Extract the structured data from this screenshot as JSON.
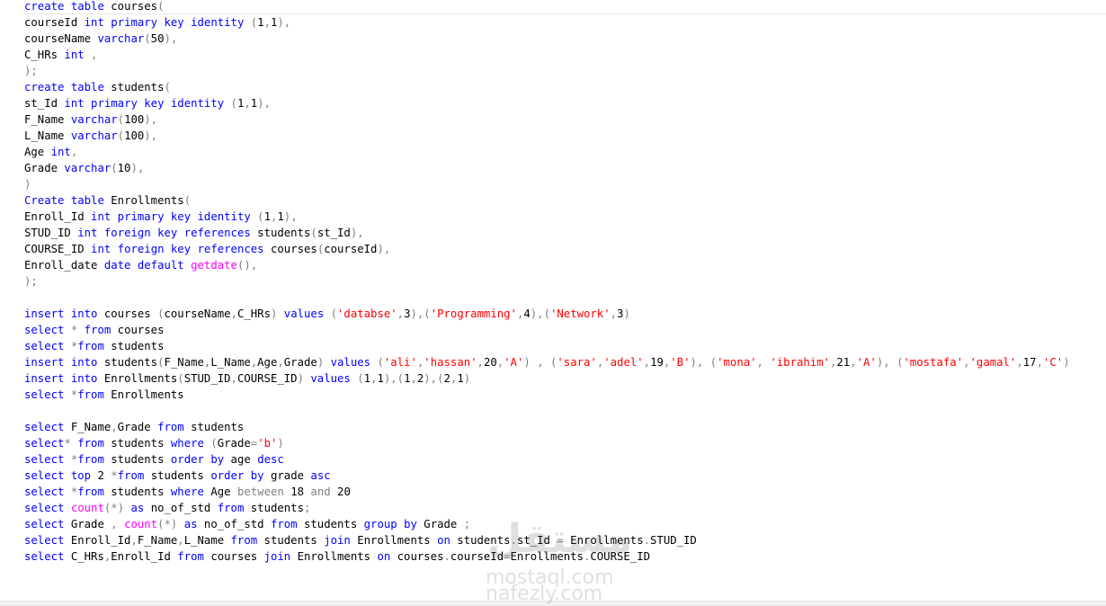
{
  "colors": {
    "keyword": "#0000ff",
    "string": "#ff0000",
    "function": "#ff00ff",
    "operator": "#808080",
    "identifier": "#000000"
  },
  "watermark": {
    "logo": "مستقل",
    "line1": "mostaql.com",
    "line2": "nafezly.com"
  },
  "lines": [
    [
      [
        "kw",
        "create"
      ],
      [
        "id",
        " "
      ],
      [
        "kw",
        "table"
      ],
      [
        "id",
        " courses"
      ],
      [
        "op",
        "("
      ]
    ],
    [
      [
        "id",
        "courseId "
      ],
      [
        "kw",
        "int"
      ],
      [
        "id",
        " "
      ],
      [
        "kw",
        "primary"
      ],
      [
        "id",
        " "
      ],
      [
        "kw",
        "key"
      ],
      [
        "id",
        " "
      ],
      [
        "kw",
        "identity"
      ],
      [
        "id",
        " "
      ],
      [
        "op",
        "("
      ],
      [
        "id",
        "1"
      ],
      [
        "op",
        ","
      ],
      [
        "id",
        "1"
      ],
      [
        "op",
        "),"
      ]
    ],
    [
      [
        "id",
        "courseName "
      ],
      [
        "kw",
        "varchar"
      ],
      [
        "op",
        "("
      ],
      [
        "id",
        "50"
      ],
      [
        "op",
        "),"
      ]
    ],
    [
      [
        "id",
        "C_HRs "
      ],
      [
        "kw",
        "int"
      ],
      [
        "id",
        " "
      ],
      [
        "op",
        ","
      ]
    ],
    [
      [
        "op",
        ");"
      ]
    ],
    [
      [
        "kw",
        "create"
      ],
      [
        "id",
        " "
      ],
      [
        "kw",
        "table"
      ],
      [
        "id",
        " students"
      ],
      [
        "op",
        "("
      ]
    ],
    [
      [
        "id",
        "st_Id "
      ],
      [
        "kw",
        "int"
      ],
      [
        "id",
        " "
      ],
      [
        "kw",
        "primary"
      ],
      [
        "id",
        " "
      ],
      [
        "kw",
        "key"
      ],
      [
        "id",
        " "
      ],
      [
        "kw",
        "identity"
      ],
      [
        "id",
        " "
      ],
      [
        "op",
        "("
      ],
      [
        "id",
        "1"
      ],
      [
        "op",
        ","
      ],
      [
        "id",
        "1"
      ],
      [
        "op",
        "),"
      ]
    ],
    [
      [
        "id",
        "F_Name "
      ],
      [
        "kw",
        "varchar"
      ],
      [
        "op",
        "("
      ],
      [
        "id",
        "100"
      ],
      [
        "op",
        "),"
      ]
    ],
    [
      [
        "id",
        "L_Name "
      ],
      [
        "kw",
        "varchar"
      ],
      [
        "op",
        "("
      ],
      [
        "id",
        "100"
      ],
      [
        "op",
        "),"
      ]
    ],
    [
      [
        "id",
        "Age "
      ],
      [
        "kw",
        "int"
      ],
      [
        "op",
        ","
      ]
    ],
    [
      [
        "id",
        "Grade "
      ],
      [
        "kw",
        "varchar"
      ],
      [
        "op",
        "("
      ],
      [
        "id",
        "10"
      ],
      [
        "op",
        "),"
      ]
    ],
    [
      [
        "op",
        ")"
      ]
    ],
    [
      [
        "kw",
        "Create"
      ],
      [
        "id",
        " "
      ],
      [
        "kw",
        "table"
      ],
      [
        "id",
        " Enrollments"
      ],
      [
        "op",
        "("
      ]
    ],
    [
      [
        "id",
        "Enroll_Id "
      ],
      [
        "kw",
        "int"
      ],
      [
        "id",
        " "
      ],
      [
        "kw",
        "primary"
      ],
      [
        "id",
        " "
      ],
      [
        "kw",
        "key"
      ],
      [
        "id",
        " "
      ],
      [
        "kw",
        "identity"
      ],
      [
        "id",
        " "
      ],
      [
        "op",
        "("
      ],
      [
        "id",
        "1"
      ],
      [
        "op",
        ","
      ],
      [
        "id",
        "1"
      ],
      [
        "op",
        "),"
      ]
    ],
    [
      [
        "id",
        "STUD_ID "
      ],
      [
        "kw",
        "int"
      ],
      [
        "id",
        " "
      ],
      [
        "kw",
        "foreign"
      ],
      [
        "id",
        " "
      ],
      [
        "kw",
        "key"
      ],
      [
        "id",
        " "
      ],
      [
        "kw",
        "references"
      ],
      [
        "id",
        " students"
      ],
      [
        "op",
        "("
      ],
      [
        "id",
        "st_Id"
      ],
      [
        "op",
        "),"
      ]
    ],
    [
      [
        "id",
        "COURSE_ID "
      ],
      [
        "kw",
        "int"
      ],
      [
        "id",
        " "
      ],
      [
        "kw",
        "foreign"
      ],
      [
        "id",
        " "
      ],
      [
        "kw",
        "key"
      ],
      [
        "id",
        " "
      ],
      [
        "kw",
        "references"
      ],
      [
        "id",
        " courses"
      ],
      [
        "op",
        "("
      ],
      [
        "id",
        "courseId"
      ],
      [
        "op",
        "),"
      ]
    ],
    [
      [
        "id",
        "Enroll_date "
      ],
      [
        "kw",
        "date"
      ],
      [
        "id",
        " "
      ],
      [
        "kw",
        "default"
      ],
      [
        "id",
        " "
      ],
      [
        "fn",
        "getdate"
      ],
      [
        "op",
        "(),"
      ]
    ],
    [
      [
        "op",
        ");"
      ]
    ],
    [],
    [
      [
        "kw",
        "insert"
      ],
      [
        "id",
        " "
      ],
      [
        "kw",
        "into"
      ],
      [
        "id",
        " courses "
      ],
      [
        "op",
        "("
      ],
      [
        "id",
        "courseName"
      ],
      [
        "op",
        ","
      ],
      [
        "id",
        "C_HRs"
      ],
      [
        "op",
        ")"
      ],
      [
        "id",
        " "
      ],
      [
        "kw",
        "values"
      ],
      [
        "id",
        " "
      ],
      [
        "op",
        "("
      ],
      [
        "str",
        "'databse'"
      ],
      [
        "op",
        ","
      ],
      [
        "id",
        "3"
      ],
      [
        "op",
        "),("
      ],
      [
        "str",
        "'Programming'"
      ],
      [
        "op",
        ","
      ],
      [
        "id",
        "4"
      ],
      [
        "op",
        "),("
      ],
      [
        "str",
        "'Network'"
      ],
      [
        "op",
        ","
      ],
      [
        "id",
        "3"
      ],
      [
        "op",
        ")"
      ]
    ],
    [
      [
        "kw",
        "select"
      ],
      [
        "id",
        " "
      ],
      [
        "op",
        "*"
      ],
      [
        "id",
        " "
      ],
      [
        "kw",
        "from"
      ],
      [
        "id",
        " courses"
      ]
    ],
    [
      [
        "kw",
        "select"
      ],
      [
        "id",
        " "
      ],
      [
        "op",
        "*"
      ],
      [
        "kw",
        "from"
      ],
      [
        "id",
        " students"
      ]
    ],
    [
      [
        "kw",
        "insert"
      ],
      [
        "id",
        " "
      ],
      [
        "kw",
        "into"
      ],
      [
        "id",
        " students"
      ],
      [
        "op",
        "("
      ],
      [
        "id",
        "F_Name"
      ],
      [
        "op",
        ","
      ],
      [
        "id",
        "L_Name"
      ],
      [
        "op",
        ","
      ],
      [
        "id",
        "Age"
      ],
      [
        "op",
        ","
      ],
      [
        "id",
        "Grade"
      ],
      [
        "op",
        ")"
      ],
      [
        "id",
        " "
      ],
      [
        "kw",
        "values"
      ],
      [
        "id",
        " "
      ],
      [
        "op",
        "("
      ],
      [
        "str",
        "'ali'"
      ],
      [
        "op",
        ","
      ],
      [
        "str",
        "'hassan'"
      ],
      [
        "op",
        ","
      ],
      [
        "id",
        "20"
      ],
      [
        "op",
        ","
      ],
      [
        "str",
        "'A'"
      ],
      [
        "op",
        ")"
      ],
      [
        "id",
        " "
      ],
      [
        "op",
        ","
      ],
      [
        "id",
        " "
      ],
      [
        "op",
        "("
      ],
      [
        "str",
        "'sara'"
      ],
      [
        "op",
        ","
      ],
      [
        "str",
        "'adel'"
      ],
      [
        "op",
        ","
      ],
      [
        "id",
        "19"
      ],
      [
        "op",
        ","
      ],
      [
        "str",
        "'B'"
      ],
      [
        "op",
        "),"
      ],
      [
        "id",
        " "
      ],
      [
        "op",
        "("
      ],
      [
        "str",
        "'mona'"
      ],
      [
        "op",
        ","
      ],
      [
        "id",
        " "
      ],
      [
        "str",
        "'ibrahim'"
      ],
      [
        "op",
        ","
      ],
      [
        "id",
        "21"
      ],
      [
        "op",
        ","
      ],
      [
        "str",
        "'A'"
      ],
      [
        "op",
        "),"
      ],
      [
        "id",
        " "
      ],
      [
        "op",
        "("
      ],
      [
        "str",
        "'mostafa'"
      ],
      [
        "op",
        ","
      ],
      [
        "str",
        "'gamal'"
      ],
      [
        "op",
        ","
      ],
      [
        "id",
        "17"
      ],
      [
        "op",
        ","
      ],
      [
        "str",
        "'C'"
      ],
      [
        "op",
        ")"
      ]
    ],
    [
      [
        "kw",
        "insert"
      ],
      [
        "id",
        " "
      ],
      [
        "kw",
        "into"
      ],
      [
        "id",
        " Enrollments"
      ],
      [
        "op",
        "("
      ],
      [
        "id",
        "STUD_ID"
      ],
      [
        "op",
        ","
      ],
      [
        "id",
        "COURSE_ID"
      ],
      [
        "op",
        ")"
      ],
      [
        "id",
        " "
      ],
      [
        "kw",
        "values"
      ],
      [
        "id",
        " "
      ],
      [
        "op",
        "("
      ],
      [
        "id",
        "1"
      ],
      [
        "op",
        ","
      ],
      [
        "id",
        "1"
      ],
      [
        "op",
        "),("
      ],
      [
        "id",
        "1"
      ],
      [
        "op",
        ","
      ],
      [
        "id",
        "2"
      ],
      [
        "op",
        "),("
      ],
      [
        "id",
        "2"
      ],
      [
        "op",
        ","
      ],
      [
        "id",
        "1"
      ],
      [
        "op",
        ")"
      ]
    ],
    [
      [
        "kw",
        "select"
      ],
      [
        "id",
        " "
      ],
      [
        "op",
        "*"
      ],
      [
        "kw",
        "from"
      ],
      [
        "id",
        " Enrollments"
      ]
    ],
    [],
    [
      [
        "kw",
        "select"
      ],
      [
        "id",
        " F_Name"
      ],
      [
        "op",
        ","
      ],
      [
        "id",
        "Grade "
      ],
      [
        "kw",
        "from"
      ],
      [
        "id",
        " students"
      ]
    ],
    [
      [
        "kw",
        "select"
      ],
      [
        "op",
        "*"
      ],
      [
        "id",
        " "
      ],
      [
        "kw",
        "from"
      ],
      [
        "id",
        " students "
      ],
      [
        "kw",
        "where"
      ],
      [
        "id",
        " "
      ],
      [
        "op",
        "("
      ],
      [
        "id",
        "Grade"
      ],
      [
        "op",
        "="
      ],
      [
        "str",
        "'b'"
      ],
      [
        "op",
        ")"
      ]
    ],
    [
      [
        "kw",
        "select"
      ],
      [
        "id",
        " "
      ],
      [
        "op",
        "*"
      ],
      [
        "kw",
        "from"
      ],
      [
        "id",
        " students "
      ],
      [
        "kw",
        "order"
      ],
      [
        "id",
        " "
      ],
      [
        "kw",
        "by"
      ],
      [
        "id",
        " age "
      ],
      [
        "kw",
        "desc"
      ]
    ],
    [
      [
        "kw",
        "select"
      ],
      [
        "id",
        " "
      ],
      [
        "kw",
        "top"
      ],
      [
        "id",
        " 2 "
      ],
      [
        "op",
        "*"
      ],
      [
        "kw",
        "from"
      ],
      [
        "id",
        " students "
      ],
      [
        "kw",
        "order"
      ],
      [
        "id",
        " "
      ],
      [
        "kw",
        "by"
      ],
      [
        "id",
        " grade "
      ],
      [
        "kw",
        "asc"
      ]
    ],
    [
      [
        "kw",
        "select"
      ],
      [
        "id",
        " "
      ],
      [
        "op",
        "*"
      ],
      [
        "kw",
        "from"
      ],
      [
        "id",
        " students "
      ],
      [
        "kw",
        "where"
      ],
      [
        "id",
        " Age "
      ],
      [
        "op",
        "between"
      ],
      [
        "id",
        " 18 "
      ],
      [
        "op",
        "and"
      ],
      [
        "id",
        " 20"
      ]
    ],
    [
      [
        "kw",
        "select"
      ],
      [
        "id",
        " "
      ],
      [
        "fn",
        "count"
      ],
      [
        "op",
        "(*)"
      ],
      [
        "id",
        " "
      ],
      [
        "kw",
        "as"
      ],
      [
        "id",
        " no_of_std "
      ],
      [
        "kw",
        "from"
      ],
      [
        "id",
        " students"
      ],
      [
        "op",
        ";"
      ]
    ],
    [
      [
        "kw",
        "select"
      ],
      [
        "id",
        " Grade "
      ],
      [
        "op",
        ","
      ],
      [
        "id",
        " "
      ],
      [
        "fn",
        "count"
      ],
      [
        "op",
        "(*)"
      ],
      [
        "id",
        " "
      ],
      [
        "kw",
        "as"
      ],
      [
        "id",
        " no_of_std "
      ],
      [
        "kw",
        "from"
      ],
      [
        "id",
        " students "
      ],
      [
        "kw",
        "group"
      ],
      [
        "id",
        " "
      ],
      [
        "kw",
        "by"
      ],
      [
        "id",
        " Grade "
      ],
      [
        "op",
        ";"
      ]
    ],
    [
      [
        "kw",
        "select"
      ],
      [
        "id",
        " Enroll_Id"
      ],
      [
        "op",
        ","
      ],
      [
        "id",
        "F_Name"
      ],
      [
        "op",
        ","
      ],
      [
        "id",
        "L_Name "
      ],
      [
        "kw",
        "from"
      ],
      [
        "id",
        " students "
      ],
      [
        "kw",
        "join"
      ],
      [
        "id",
        " Enrollments "
      ],
      [
        "kw",
        "on"
      ],
      [
        "id",
        " students"
      ],
      [
        "op",
        "."
      ],
      [
        "id",
        "st_Id "
      ],
      [
        "op",
        "="
      ],
      [
        "id",
        " Enrollments"
      ],
      [
        "op",
        "."
      ],
      [
        "id",
        "STUD_ID"
      ]
    ],
    [
      [
        "kw",
        "select"
      ],
      [
        "id",
        " C_HRs"
      ],
      [
        "op",
        ","
      ],
      [
        "id",
        "Enroll_Id "
      ],
      [
        "kw",
        "from"
      ],
      [
        "id",
        " courses "
      ],
      [
        "kw",
        "join"
      ],
      [
        "id",
        " Enrollments "
      ],
      [
        "kw",
        "on"
      ],
      [
        "id",
        " courses"
      ],
      [
        "op",
        "."
      ],
      [
        "id",
        "courseId"
      ],
      [
        "op",
        "="
      ],
      [
        "id",
        "Enrollments"
      ],
      [
        "op",
        "."
      ],
      [
        "id",
        "COURSE_ID"
      ]
    ]
  ]
}
